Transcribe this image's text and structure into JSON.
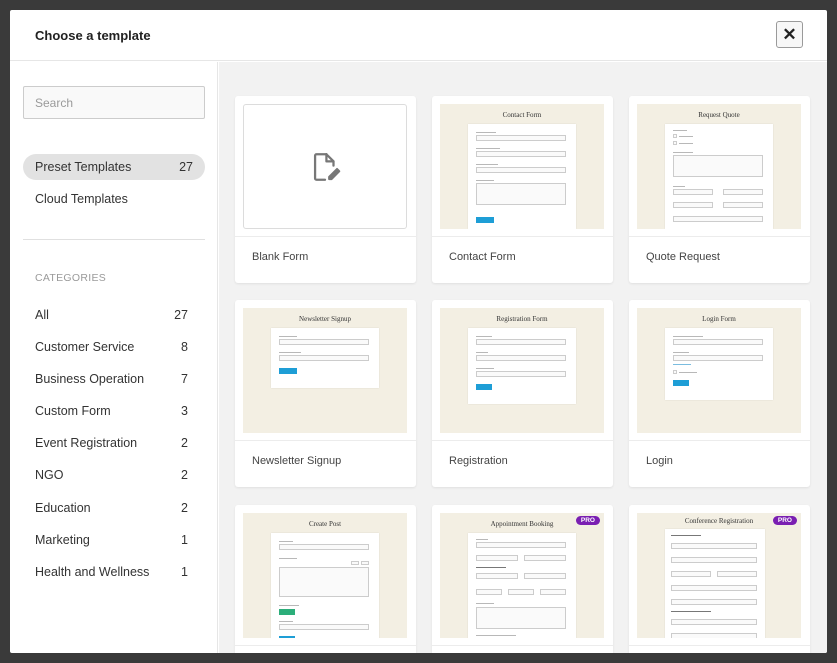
{
  "header": {
    "title": "Choose a template",
    "close_label": "✕"
  },
  "sidebar": {
    "search_placeholder": "Search",
    "sources": [
      {
        "label": "Preset Templates",
        "count": "27"
      },
      {
        "label": "Cloud Templates",
        "count": ""
      }
    ],
    "categories_heading": "CATEGORIES",
    "categories": [
      {
        "label": "All",
        "count": "27"
      },
      {
        "label": "Customer Service",
        "count": "8"
      },
      {
        "label": "Business Operation",
        "count": "7"
      },
      {
        "label": "Custom Form",
        "count": "3"
      },
      {
        "label": "Event Registration",
        "count": "2"
      },
      {
        "label": "NGO",
        "count": "2"
      },
      {
        "label": "Education",
        "count": "2"
      },
      {
        "label": "Marketing",
        "count": "1"
      },
      {
        "label": "Health and Wellness",
        "count": "1"
      }
    ]
  },
  "templates": [
    {
      "label": "Blank Form",
      "preview_title": ""
    },
    {
      "label": "Contact Form",
      "preview_title": "Contact Form"
    },
    {
      "label": "Quote Request",
      "preview_title": "Request Quote"
    },
    {
      "label": "Newsletter Signup",
      "preview_title": "Newsletter Signup"
    },
    {
      "label": "Registration",
      "preview_title": "Registration Form"
    },
    {
      "label": "Login",
      "preview_title": "Login Form"
    },
    {
      "label": "",
      "preview_title": "Create Post"
    },
    {
      "label": "",
      "preview_title": "Appointment Booking",
      "badge": "PRO"
    },
    {
      "label": "",
      "preview_title": "Conference Registration",
      "badge": "PRO"
    }
  ],
  "colors": {
    "accent": "#1e9ed6",
    "pro_badge": "#7a1fb2",
    "thumb_bg": "#f3efe3"
  },
  "icons": {
    "blank_form": "file-edit-icon",
    "close": "close-icon"
  }
}
